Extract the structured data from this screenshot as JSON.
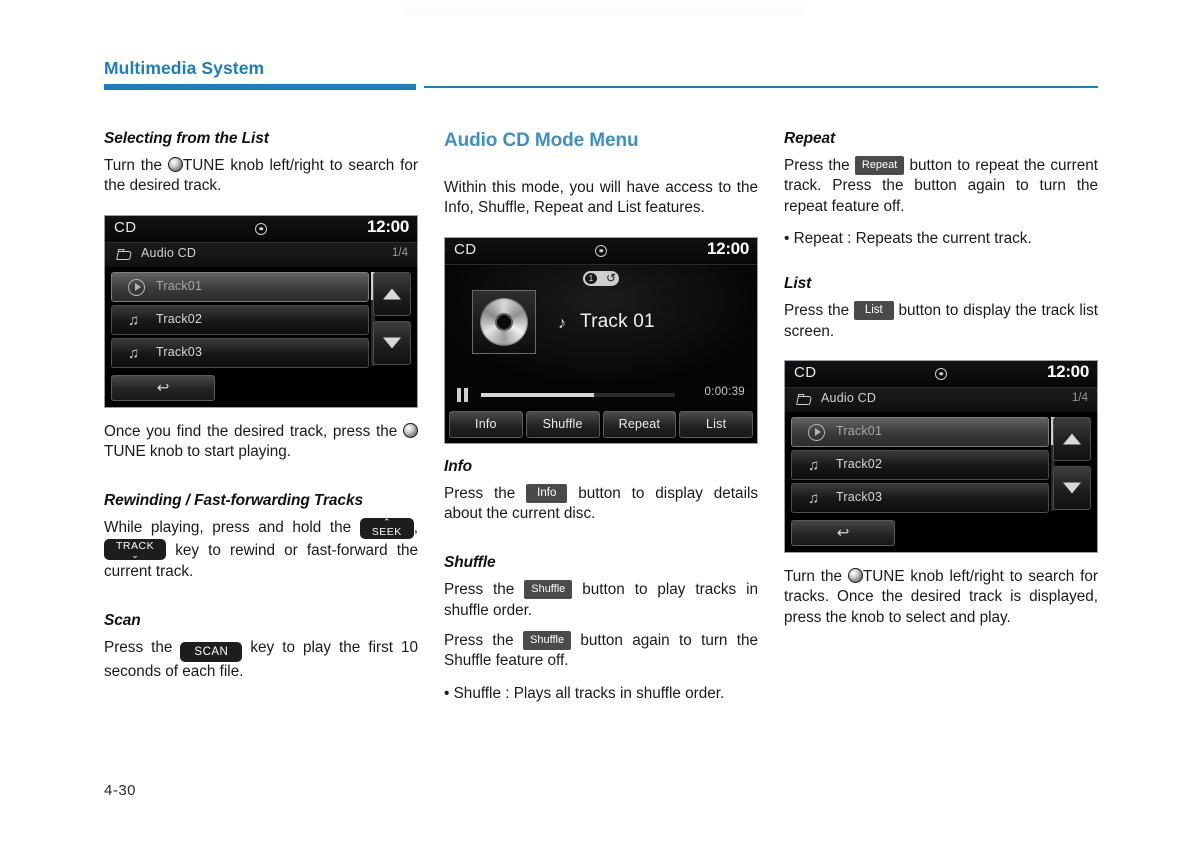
{
  "header": {
    "title": "Multimedia System",
    "accent_color": "#1b7ec2"
  },
  "page_number": "4-30",
  "column1": {
    "section1": {
      "heading": "Selecting from the List",
      "para_before_knob": "Turn the",
      "para_after_knob": "TUNE knob left/right to search for the desired track.",
      "after_fig_before_knob": "Once you find the desired track, press the",
      "after_fig_after_knob": "TUNE knob to start playing."
    },
    "section2": {
      "heading": "Rewinding / Fast-forwarding Tracks",
      "text_start": "While playing, press and hold the",
      "key_seek": "SEEK",
      "key_seek_chevron": "⌃",
      "comma": ",",
      "key_track": "TRACK",
      "key_track_chevron": "⌄",
      "text_end": "key to rewind or fast-forward the current track."
    },
    "section3": {
      "heading": "Scan",
      "text_start": "Press the",
      "key_scan": "SCAN",
      "text_end": "key to play the first 10 seconds of each file."
    },
    "list_screen": {
      "source": "CD",
      "disc_icon": "disc-icon",
      "clock": "12:00",
      "breadcrumb": "Audio CD",
      "page_count": "1/4",
      "tracks": [
        {
          "label": "Track01",
          "icon": "play-circle-icon",
          "selected": true
        },
        {
          "label": "Track02",
          "icon": "music-note-icon",
          "selected": false
        },
        {
          "label": "Track03",
          "icon": "music-note-icon",
          "selected": false
        }
      ],
      "scroll_up": "▲",
      "scroll_down": "▼",
      "back_icon": "↩"
    }
  },
  "column2": {
    "heading": "Audio CD Mode Menu",
    "intro": "Within this mode, you will have access to the Info, Shuffle, Repeat and List features.",
    "now_playing": {
      "source": "CD",
      "disc_icon": "disc-icon",
      "clock": "12:00",
      "repeat_badge": "1",
      "repeat_icon": "↺",
      "album_art": "cd-disc-art",
      "note_icon": "♪",
      "track_title": "Track 01",
      "play_state_icon": "pause-icon",
      "elapsed_time": "0:00:39",
      "progress_percent": 58,
      "tabs": [
        "Info",
        "Shuffle",
        "Repeat",
        "List"
      ]
    },
    "info": {
      "heading": "Info",
      "text_start": "Press the",
      "chip": "Info",
      "text_end": "button to display details about the current disc."
    },
    "shuffle": {
      "heading": "Shuffle",
      "p1_start": "Press the",
      "p1_chip": "Shuffle",
      "p1_end": "button to play tracks in shuffle order.",
      "p2_start": "Press the",
      "p2_chip": "Shuffle",
      "p2_end": "button again to turn the Shuffle feature off.",
      "bullet": "• Shuffle : Plays all tracks in shuffle order."
    }
  },
  "column3": {
    "repeat": {
      "heading": "Repeat",
      "text_start": "Press the",
      "chip": "Repeat",
      "text_end": "button to repeat the current track. Press the button again to turn the repeat feature off.",
      "bullet": "• Repeat : Repeats the current track."
    },
    "list": {
      "heading": "List",
      "text_start": "Press the",
      "chip": "List",
      "text_end": "button to display the track list screen."
    },
    "list_screen": {
      "source": "CD",
      "disc_icon": "disc-icon",
      "clock": "12:00",
      "breadcrumb": "Audio CD",
      "page_count": "1/4",
      "tracks": [
        {
          "label": "Track01",
          "icon": "play-circle-icon",
          "selected": true
        },
        {
          "label": "Track02",
          "icon": "music-note-icon",
          "selected": false
        },
        {
          "label": "Track03",
          "icon": "music-note-icon",
          "selected": false
        }
      ],
      "scroll_up": "▲",
      "scroll_down": "▼",
      "back_icon": "↩"
    },
    "after_text_before_knob": "Turn the",
    "after_text_after_knob": "TUNE knob left/right to search for tracks. Once the desired track is displayed, press the knob to select and play."
  }
}
